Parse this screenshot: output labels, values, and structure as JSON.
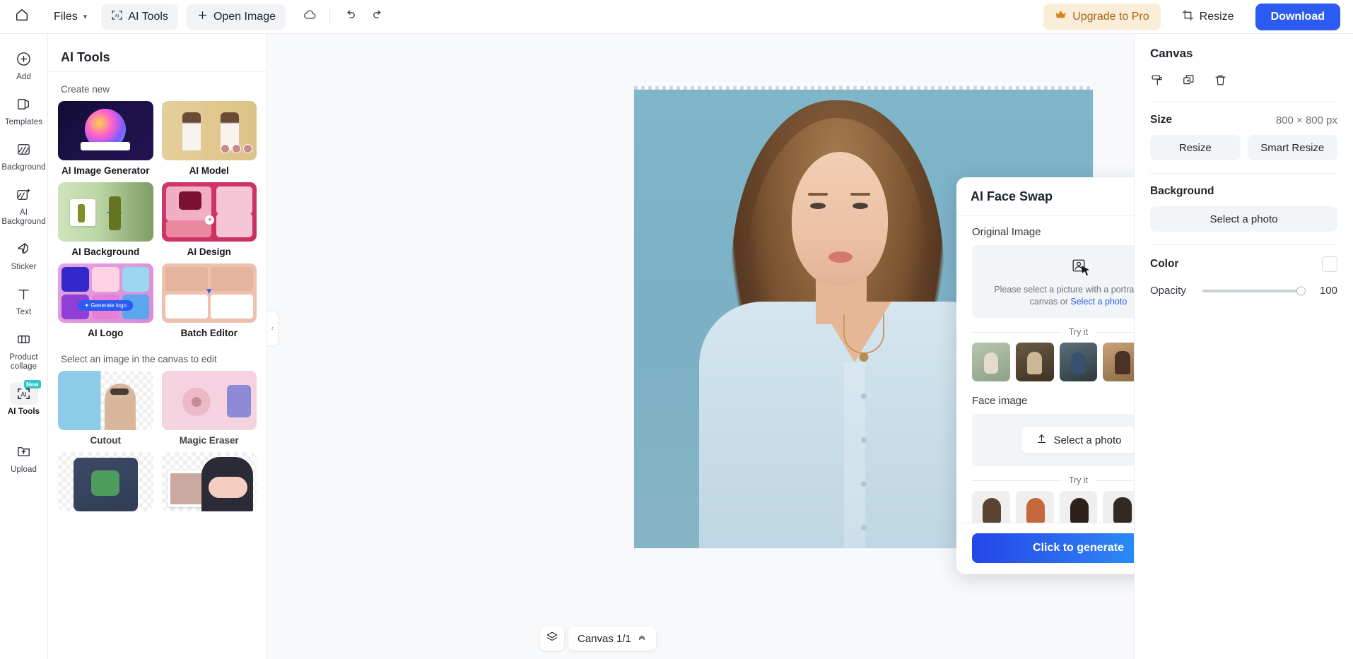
{
  "topbar": {
    "home_icon": "home-icon",
    "files_label": "Files",
    "ai_tools_label": "AI Tools",
    "open_image_label": "Open Image",
    "cloud_icon": "cloud-sync-icon",
    "undo_icon": "undo-icon",
    "redo_icon": "redo-icon",
    "upgrade_label": "Upgrade to Pro",
    "crown_icon": "crown-icon",
    "resize_label": "Resize",
    "resize_icon": "crop-icon",
    "download_label": "Download",
    "accent_blue": "#2b5bf0",
    "upgrade_bg": "#fbeed9",
    "upgrade_fg": "#a9651b"
  },
  "rail": {
    "items": [
      {
        "label": "Add",
        "icon": "plus-circle-icon",
        "active": false
      },
      {
        "label": "Templates",
        "icon": "templates-icon",
        "active": false
      },
      {
        "label": "Background",
        "icon": "background-icon",
        "active": false
      },
      {
        "label": "AI Background",
        "icon": "ai-background-icon",
        "active": false
      },
      {
        "label": "Sticker",
        "icon": "sticker-icon",
        "active": false
      },
      {
        "label": "Text",
        "icon": "text-icon",
        "active": false
      },
      {
        "label": "Product collage",
        "icon": "product-collage-icon",
        "active": false
      },
      {
        "label": "AI Tools",
        "icon": "ai-tools-icon",
        "active": true,
        "badge": "New"
      },
      {
        "label": "Upload",
        "icon": "upload-icon",
        "active": false
      }
    ]
  },
  "panel": {
    "title": "AI Tools",
    "create_new_label": "Create new",
    "create_new_tools": [
      {
        "name": "AI Image Generator",
        "art": "th-aigen"
      },
      {
        "name": "AI Model",
        "art": "th-model"
      },
      {
        "name": "AI Background",
        "art": "th-bg"
      },
      {
        "name": "AI Design",
        "art": "th-design"
      },
      {
        "name": "AI Logo",
        "art": "th-logo"
      },
      {
        "name": "Batch Editor",
        "art": "th-batch"
      }
    ],
    "edit_label": "Select an image in the canvas to edit",
    "edit_tools": [
      {
        "name": "Cutout",
        "art": "th-cutout"
      },
      {
        "name": "Magic Eraser",
        "art": "th-eraser"
      },
      {
        "name": "",
        "art": "th-green"
      },
      {
        "name": "",
        "art": "th-anime"
      }
    ],
    "collapse_icon": "chevron-left-icon"
  },
  "canvas": {
    "layers_icon": "layers-icon",
    "canvas_label": "Canvas 1/1",
    "expand_icon": "chevron-up-icon"
  },
  "faceswap": {
    "title": "AI Face Swap",
    "close_icon": "close-icon",
    "original_image_label": "Original Image",
    "placeholder_icon": "portrait-placeholder-icon",
    "placeholder_text": "Please select a picture with a portrait in the canvas or ",
    "placeholder_link": "Select a photo",
    "try_it_label": "Try it",
    "original_samples": [
      "p1",
      "p2",
      "p3",
      "p4",
      "p5"
    ],
    "face_image_label": "Face image",
    "select_photo_label": "Select a photo",
    "upload_icon": "upload-arrow-icon",
    "face_samples": [
      "f1b",
      "f2b",
      "f3b",
      "f4b",
      "f5b"
    ],
    "generate_label": "Click to generate"
  },
  "right": {
    "title": "Canvas",
    "icons": [
      "paint-roller-icon",
      "duplicate-icon",
      "trash-icon"
    ],
    "size_label": "Size",
    "size_value": "800 × 800 px",
    "resize_label": "Resize",
    "smart_resize_label": "Smart Resize",
    "background_label": "Background",
    "select_photo_label": "Select a photo",
    "color_label": "Color",
    "color_value": "#ffffff",
    "opacity_label": "Opacity",
    "opacity_value": "100"
  }
}
